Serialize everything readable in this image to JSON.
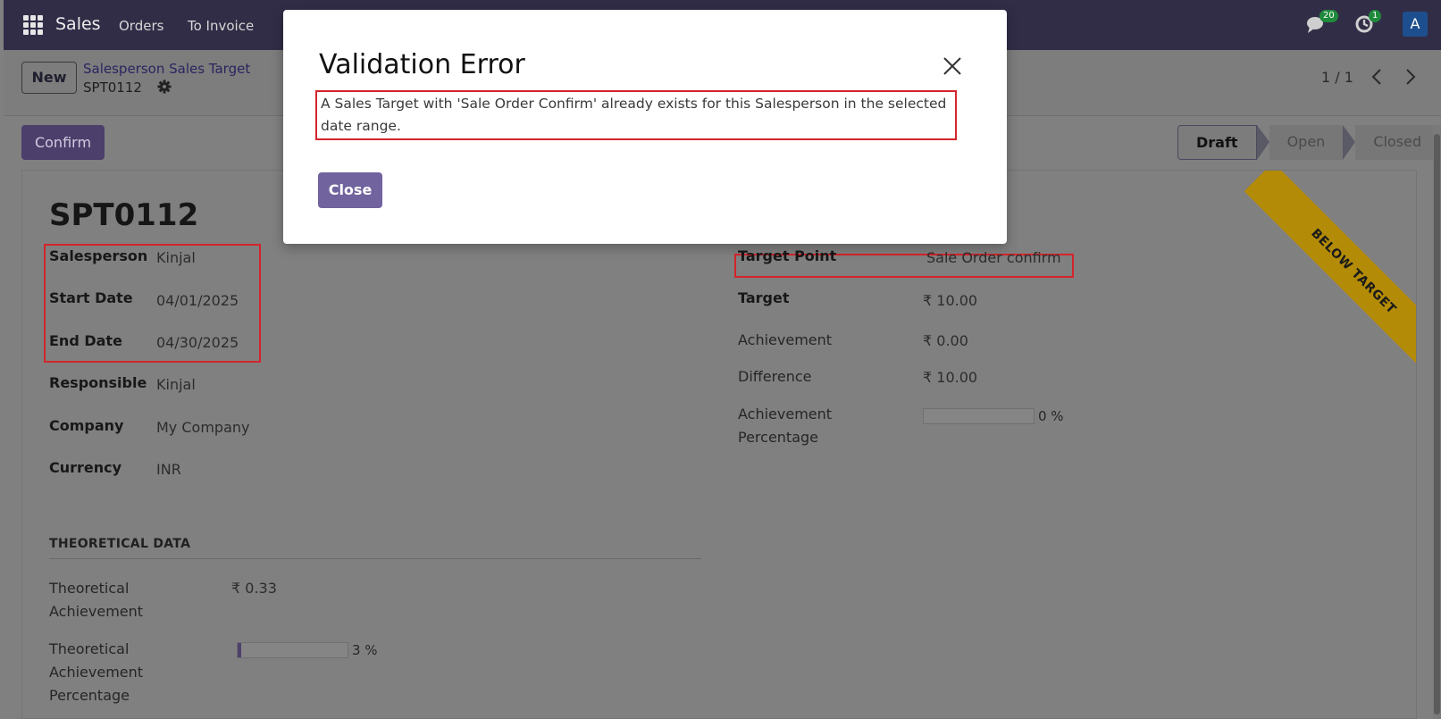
{
  "navbar": {
    "brand": "Sales",
    "menu": [
      "Orders",
      "To Invoice"
    ],
    "chat_count": "20",
    "activity_count": "1",
    "avatar_letter": "A"
  },
  "control_panel": {
    "new_label": "New",
    "breadcrumb_parent": "Salesperson Sales Target",
    "breadcrumb_current": "SPT0112",
    "pager": "1 / 1"
  },
  "status_row": {
    "confirm_label": "Confirm",
    "stages": [
      "Draft",
      "Open",
      "Closed"
    ],
    "active_stage": "Draft"
  },
  "form": {
    "title": "SPT0112",
    "ribbon": "BELOW TARGET",
    "left_fields": [
      {
        "label": "Salesperson",
        "value": "Kinjal"
      },
      {
        "label": "Start Date",
        "value": "04/01/2025"
      },
      {
        "label": "End Date",
        "value": "04/30/2025"
      },
      {
        "label": "Responsible",
        "value": "Kinjal"
      },
      {
        "label": "Company",
        "value": "My Company"
      },
      {
        "label": "Currency",
        "value": "INR"
      }
    ],
    "right_fields": [
      {
        "label": "Target Point",
        "value": "Sale Order confirm"
      },
      {
        "label": "Target",
        "value": "₹ 10.00"
      },
      {
        "label": "Achievement",
        "value": "₹ 0.00"
      },
      {
        "label": "Difference",
        "value": "₹ 10.00"
      }
    ],
    "achievement_percentage": {
      "label_1": "Achievement",
      "label_2": "Percentage",
      "value": 0,
      "value_text": "0 %"
    },
    "theoretical": {
      "section_title": "THEORETICAL DATA",
      "achievement_label_1": "Theoretical",
      "achievement_label_2": "Achievement",
      "achievement_value": "₹ 0.33",
      "percentage_label_1": "Theoretical",
      "percentage_label_2": "Achievement",
      "percentage_label_3": "Percentage",
      "percentage_value": 3,
      "percentage_text": "3 %"
    }
  },
  "modal": {
    "title": "Validation Error",
    "message": "A Sales Target with 'Sale Order Confirm' already exists for this Salesperson in the selected date range.",
    "close_label": "Close"
  },
  "colors": {
    "navbar": "#322d47",
    "primary": "#71639e",
    "ribbon": "#b38b06",
    "highlight": "#d4242b"
  }
}
